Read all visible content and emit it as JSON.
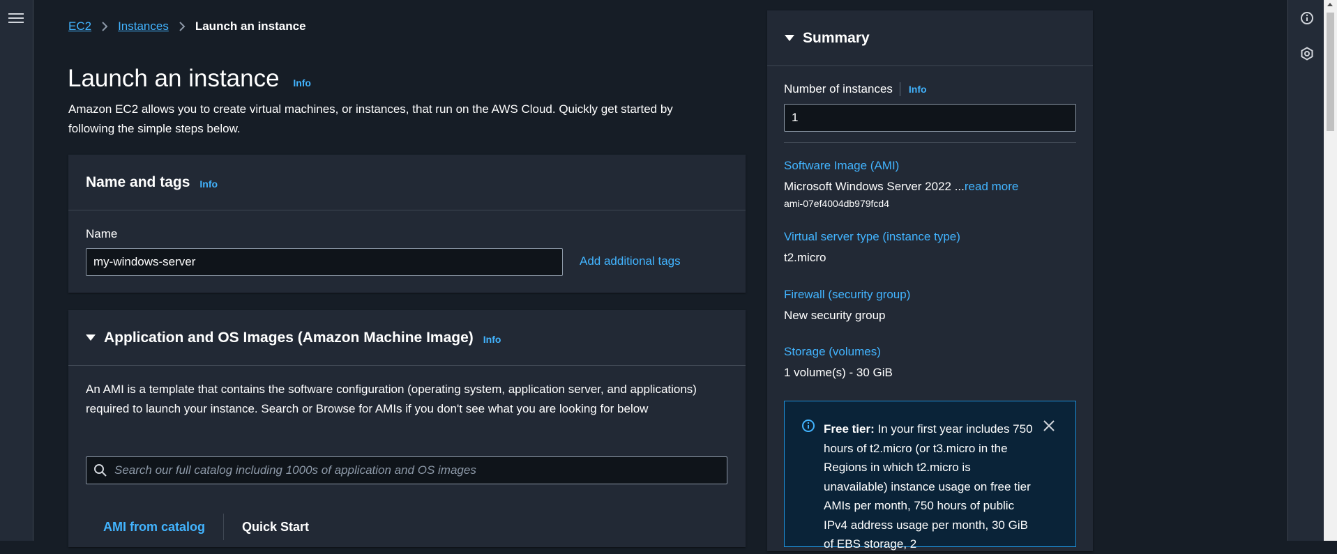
{
  "breadcrumb": {
    "items": [
      "EC2",
      "Instances"
    ],
    "current": "Launch an instance"
  },
  "page": {
    "title": "Launch an instance",
    "info": "Info",
    "description": "Amazon EC2 allows you to create virtual machines, or instances, that run on the AWS Cloud. Quickly get started by following the simple steps below."
  },
  "name_tags": {
    "title": "Name and tags",
    "info": "Info",
    "name_label": "Name",
    "name_value": "my-windows-server",
    "add_tags": "Add additional tags"
  },
  "ami": {
    "title": "Application and OS Images (Amazon Machine Image)",
    "info": "Info",
    "description": "An AMI is a template that contains the software configuration (operating system, application server, and applications) required to launch your instance. Search or Browse for AMIs if you don't see what you are looking for below",
    "search_placeholder": "Search our full catalog including 1000s of application and OS images",
    "tabs": [
      "AMI from catalog",
      "Quick Start"
    ]
  },
  "summary": {
    "title": "Summary",
    "num_instances_label": "Number of instances",
    "info": "Info",
    "num_instances_value": "1",
    "ami_label": "Software Image (AMI)",
    "ami_value": "Microsoft Windows Server 2022 ...",
    "read_more": "read more",
    "ami_id": "ami-07ef4004db979fcd4",
    "type_label": "Virtual server type (instance type)",
    "type_value": "t2.micro",
    "firewall_label": "Firewall (security group)",
    "firewall_value": "New security group",
    "storage_label": "Storage (volumes)",
    "storage_value": "1 volume(s) - 30 GiB",
    "free_tier_title": "Free tier:",
    "free_tier_text": "In your first year includes 750 hours of t2.micro (or t3.micro in the Regions in which t2.micro is unavailable) instance usage on free tier AMIs per month, 750 hours of public IPv4 address usage per month, 30 GiB of EBS storage, 2"
  },
  "colors": {
    "background": "#161d26",
    "panel": "#222935",
    "link": "#42b4ff",
    "alert_bg": "#0a2338",
    "alert_border": "#1f8ed6"
  }
}
